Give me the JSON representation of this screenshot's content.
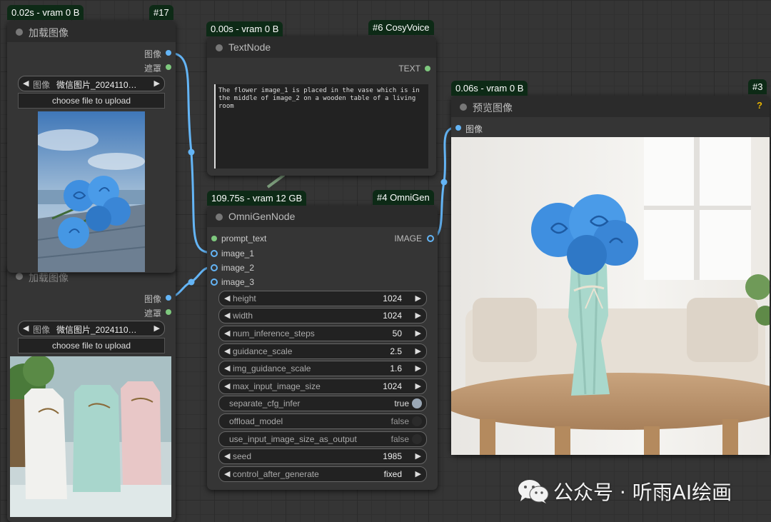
{
  "badges": {
    "n17_time": "0.02s - vram 0 B",
    "n17_id": "#17",
    "n6_time": "0.00s - vram 0 B",
    "n6_id": "#6 CosyVoice",
    "n3_time": "0.06s - vram 0 B",
    "n3_id": "#3",
    "n4_time": "109.75s - vram 12 GB",
    "n4_id": "#4 OmniGen"
  },
  "load1": {
    "title": "加载图像",
    "out_image": "图像",
    "out_mask": "遮罩",
    "combo_label": "图像",
    "combo_value": "微信图片_2024110…",
    "upload": "choose file to upload"
  },
  "load2": {
    "title": "加载图像",
    "out_image": "图像",
    "out_mask": "遮罩",
    "combo_label": "图像",
    "combo_value": "微信图片_2024110…",
    "upload": "choose file to upload"
  },
  "textnode": {
    "title": "TextNode",
    "out_text": "TEXT",
    "text": "The flower image_1 is placed in the vase which is in the middle of image_2 on a wooden table of a living room"
  },
  "omnigen": {
    "title": "OmniGenNode",
    "inputs": [
      "prompt_text",
      "image_1",
      "image_2",
      "image_3"
    ],
    "output": "IMAGE",
    "widgets": [
      {
        "name": "height",
        "value": "1024",
        "kind": "number"
      },
      {
        "name": "width",
        "value": "1024",
        "kind": "number"
      },
      {
        "name": "num_inference_steps",
        "value": "50",
        "kind": "number"
      },
      {
        "name": "guidance_scale",
        "value": "2.5",
        "kind": "number"
      },
      {
        "name": "img_guidance_scale",
        "value": "1.6",
        "kind": "number"
      },
      {
        "name": "max_input_image_size",
        "value": "1024",
        "kind": "number"
      },
      {
        "name": "separate_cfg_infer",
        "value": "true",
        "kind": "toggle"
      },
      {
        "name": "offload_model",
        "value": "false",
        "kind": "toggle"
      },
      {
        "name": "use_input_image_size_as_output",
        "value": "false",
        "kind": "toggle"
      },
      {
        "name": "seed",
        "value": "1985",
        "kind": "number"
      },
      {
        "name": "control_after_generate",
        "value": "fixed",
        "kind": "combo"
      }
    ]
  },
  "preview": {
    "title": "预览图像",
    "in_image": "图像",
    "help": "?"
  },
  "watermark": {
    "text": "公众号 · 听雨AI绘画"
  },
  "colors": {
    "canvas": "#353535",
    "node_body": "#353535",
    "node_header": "#2b2b2b",
    "wire_image": "#64b5f6",
    "wire_text": "#7ec87e",
    "badge_bg": "#0d2a16",
    "help": "#e8b400"
  }
}
